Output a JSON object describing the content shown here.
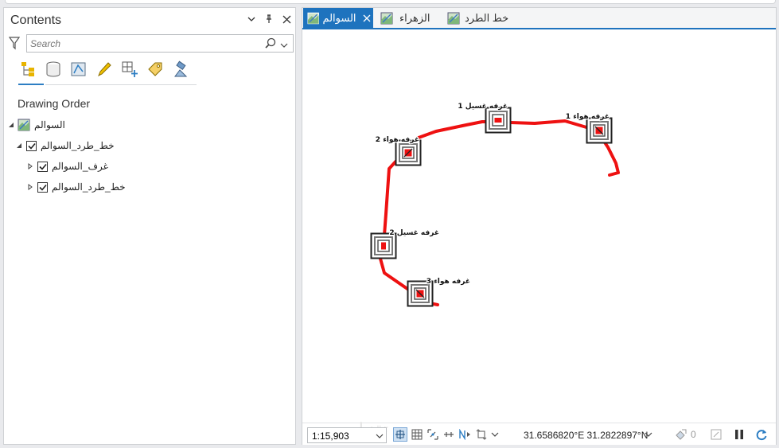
{
  "contents_pane": {
    "title": "Contents",
    "search_placeholder": "Search",
    "drawing_order_label": "Drawing Order",
    "tools": [
      "list-by-drawing-order-icon",
      "list-by-data-source-icon",
      "list-by-selection-icon",
      "list-by-editing-icon",
      "list-by-snapping-icon",
      "list-by-labeling-icon",
      "list-by-perspective-imagery-icon"
    ],
    "tree": [
      {
        "label": "السوالم",
        "type": "map"
      },
      {
        "label": "خط_طرد_السوالم",
        "type": "group",
        "checked": true
      },
      {
        "label": "غرف_السوالم",
        "type": "layer",
        "checked": true
      },
      {
        "label": "خط_طرد_السوالم",
        "type": "layer",
        "checked": true
      }
    ]
  },
  "map_view": {
    "tabs": [
      {
        "label": "السوالم",
        "active": true
      },
      {
        "label": "الزهراء",
        "active": false
      },
      {
        "label": "خط الطرد",
        "active": false
      }
    ],
    "features": [
      {
        "label": "غرفه هواء 1"
      },
      {
        "label": "غرفه غسيل 1"
      },
      {
        "label": "غرفه هواء 2"
      },
      {
        "label": "غرفه غسيل 2"
      },
      {
        "label": "غرفه هواء 3"
      }
    ],
    "line_color": "#ee1111",
    "status": {
      "scale": "1:15,903",
      "coordinates": "31.6586820°E 31.2822897°N",
      "selected_count": "0",
      "watermark": "تقنيات"
    }
  },
  "colors": {
    "accent": "#1e73be",
    "feature_red": "#ee1111"
  }
}
